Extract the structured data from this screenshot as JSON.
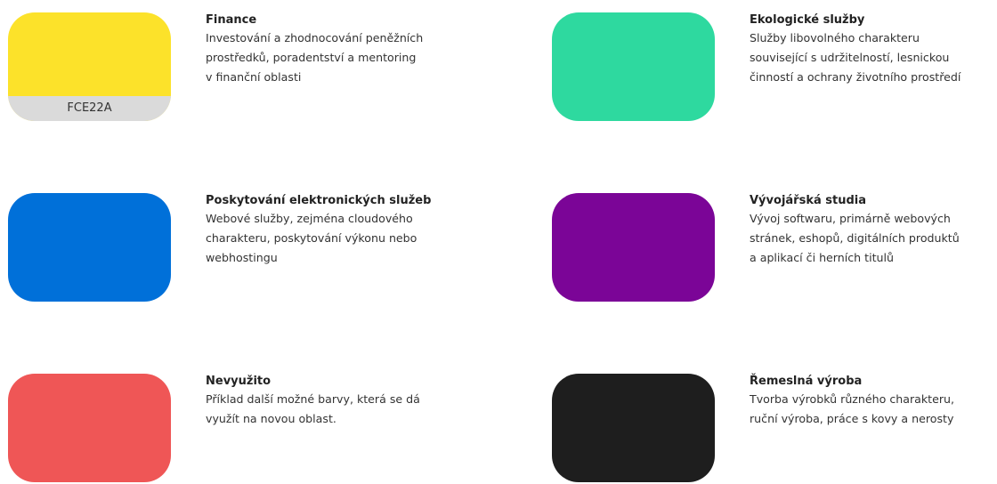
{
  "items": [
    {
      "name": "finance",
      "color": "#FCE22A",
      "code": "FCE22A",
      "title": "Finance",
      "lines": [
        "Investování a zhodnocování peněžních",
        "prostředků, poradentství a mentoring",
        "v finanční oblasti"
      ]
    },
    {
      "name": "ekologicke-sluzby",
      "color": "#2ED99F",
      "title": "Ekologické služby",
      "lines": [
        "Služby libovolného charakteru",
        "související s udržitelností, lesnickou",
        "činností a ochrany životního prostředí"
      ]
    },
    {
      "name": "elektronicke-sluzby",
      "color": "#0070D9",
      "title": "Poskytování elektronických služeb",
      "lines": [
        "Webové služby, zejména cloudového",
        "charakteru, poskytování výkonu nebo",
        "webhostingu"
      ]
    },
    {
      "name": "vyvojarska-studia",
      "color": "#7B0597",
      "title": "Vývojářská studia",
      "lines": [
        "Vývoj softwaru, primárně webových",
        "stránek, eshopů, digitálních produktů",
        "a aplikací či herních titulů"
      ]
    },
    {
      "name": "nevyuzito",
      "color": "#EF5656",
      "title": "Nevyužito",
      "lines": [
        "Příklad další možné barvy, která se dá",
        "využít na novou oblast."
      ]
    },
    {
      "name": "remeslna-vyroba",
      "color": "#1E1E1E",
      "title": "Řemeslná výroba",
      "lines": [
        "Tvorba výrobků různého charakteru,",
        "ruční výroba, práce s kovy a nerosty"
      ]
    }
  ]
}
